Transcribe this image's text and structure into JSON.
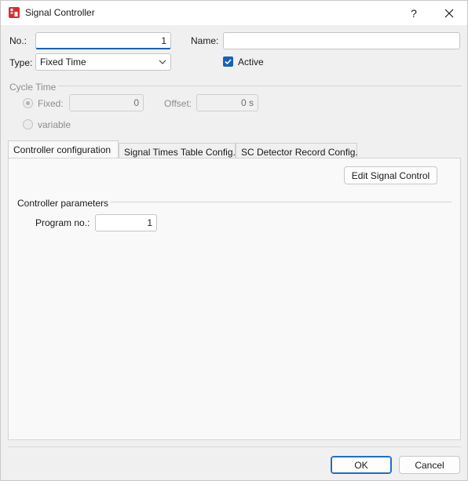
{
  "window": {
    "title": "Signal Controller",
    "help_label": "?",
    "close_label": "✕"
  },
  "form": {
    "no_label": "No.:",
    "no_value": "1",
    "name_label": "Name:",
    "name_value": "",
    "type_label": "Type:",
    "type_value": "Fixed Time",
    "active_label": "Active",
    "active_checked": true
  },
  "cycle_time": {
    "section_label": "Cycle Time",
    "fixed_label": "Fixed:",
    "fixed_value": "0",
    "offset_label": "Offset:",
    "offset_value": "0 s",
    "variable_label": "variable"
  },
  "tabs": [
    {
      "label": "Controller configuration",
      "active": true
    },
    {
      "label": "Signal Times Table Config.",
      "active": false
    },
    {
      "label": "SC Detector Record Config.",
      "active": false
    }
  ],
  "panel": {
    "edit_button": "Edit Signal Control",
    "params_section": "Controller parameters",
    "program_label": "Program no.:",
    "program_value": "1"
  },
  "footer": {
    "ok_label": "OK",
    "cancel_label": "Cancel"
  },
  "colors": {
    "accent": "#1463b8",
    "app_icon": "#d32f2f"
  }
}
